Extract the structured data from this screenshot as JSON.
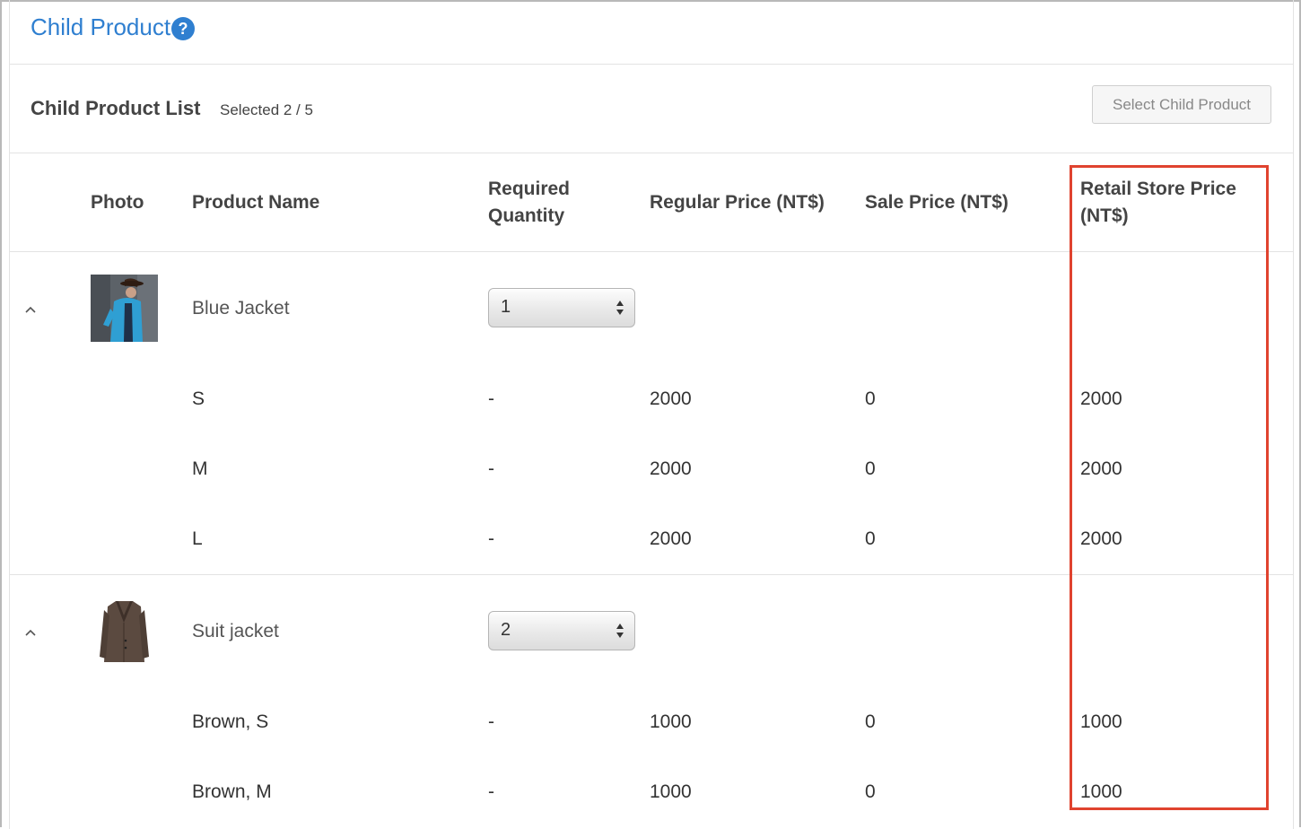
{
  "header": {
    "title": "Child Product",
    "help_icon": "question-circle-icon"
  },
  "list": {
    "title": "Child Product List",
    "count": "Selected 2 / 5",
    "select_button": "Select Child Product"
  },
  "table": {
    "columns": {
      "photo": "Photo",
      "name": "Product Name",
      "qty_1": "Required",
      "qty_2": "Quantity",
      "regular": "Regular Price (NT$)",
      "sale": "Sale Price (NT$)",
      "retail_1": "Retail Store Price",
      "retail_2": "(NT$)"
    },
    "groups": [
      {
        "name": "Blue Jacket",
        "quantity": "1",
        "variants": [
          {
            "name": "S",
            "qty": "-",
            "regular": "2000",
            "sale": "0",
            "retail": "2000"
          },
          {
            "name": "M",
            "qty": "-",
            "regular": "2000",
            "sale": "0",
            "retail": "2000"
          },
          {
            "name": "L",
            "qty": "-",
            "regular": "2000",
            "sale": "0",
            "retail": "2000"
          }
        ]
      },
      {
        "name": "Suit jacket",
        "quantity": "2",
        "variants": [
          {
            "name": "Brown, S",
            "qty": "-",
            "regular": "1000",
            "sale": "0",
            "retail": "1000"
          },
          {
            "name": "Brown, M",
            "qty": "-",
            "regular": "1000",
            "sale": "0",
            "retail": "1000"
          }
        ]
      }
    ]
  },
  "colors": {
    "link": "#2f7fd0",
    "highlight": "#e0432f"
  }
}
